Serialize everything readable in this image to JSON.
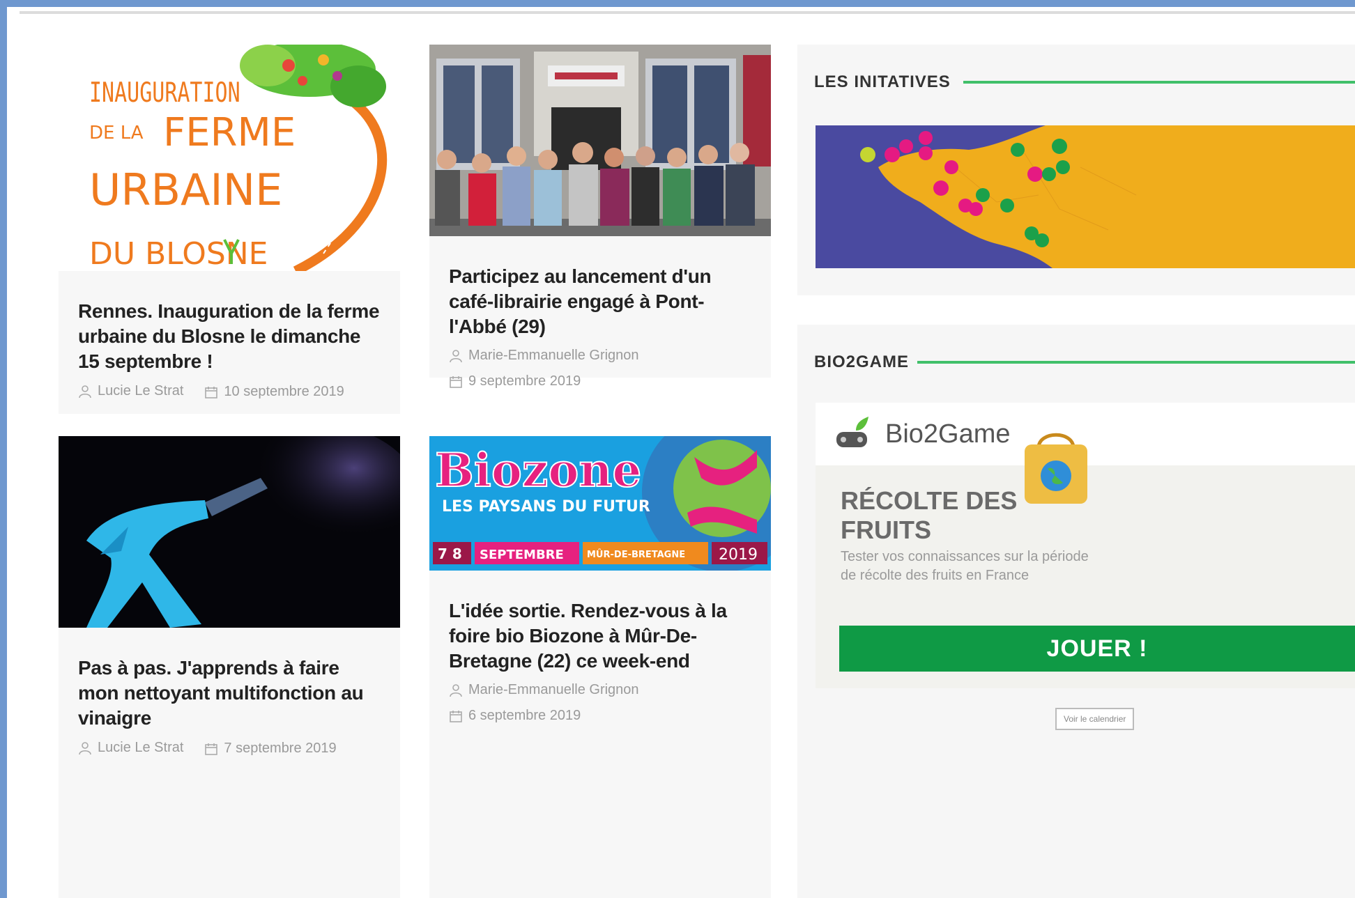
{
  "articles": [
    {
      "title": "Rennes. Inauguration de la ferme urbaine du Blosne le dimanche 15 septembre !",
      "author": "Lucie Le Strat",
      "date": "10 septembre 2019",
      "image_text": {
        "line1": "INAUGURATION",
        "line2a": "DE LA",
        "line2b": "FERME",
        "line3": "URBAINE",
        "line4": "DU BLOSNE"
      }
    },
    {
      "title": "Participez au lancement d'un café-librairie engagé à Pont-l'Abbé (29)",
      "author": "Marie-Emmanuelle Grignon",
      "date": "9 septembre 2019"
    },
    {
      "title": "Pas à pas. J'apprends à faire mon nettoyant multifonction au vinaigre",
      "author": "Lucie Le Strat",
      "date": "7 septembre 2019"
    },
    {
      "title": "L'idée sortie. Rendez-vous à la foire bio Biozone à Mûr-De-Bretagne (22) ce week-end",
      "author": "Marie-Emmanuelle Grignon",
      "date": "6 septembre 2019",
      "image_text": {
        "brand": "Biozone",
        "tagline": "LES PAYSANS DU FUTUR",
        "days": "7 8",
        "month": "SEPTEMBRE",
        "place": "MÛR-DE-BRETAGNE",
        "year": "2019"
      }
    }
  ],
  "sidebar": {
    "initiatives_title": "LES INITATIVES",
    "bio2game_title": "BIO2GAME",
    "game": {
      "brand": "Bio2Game",
      "heading": "RÉCOLTE DES FRUITS",
      "description": "Tester vos connaissances sur la période de récolte des fruits en France",
      "button": "JOUER !",
      "calendar_link": "Voir le calendrier"
    }
  },
  "colors": {
    "accent_green": "#41c06a",
    "button_green": "#0f9a45",
    "orange": "#ef7a1e",
    "map_sea": "#4a4aa0",
    "map_land": "#f0ad1c",
    "biozone_pink": "#e6217f",
    "biozone_blue": "#1aa0e0"
  }
}
